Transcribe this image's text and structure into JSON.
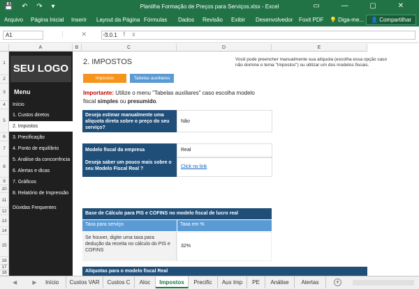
{
  "titlebar": {
    "title": "Planilha Formação de Preços para Serviços.xlsx - Excel",
    "quick_access": "💾 ↶ ↷ ▾",
    "window_controls": "▭ — ▢ ✕"
  },
  "ribbon": {
    "tabs": [
      "Arquivo",
      "Página Inicial",
      "Inserir",
      "Layout da Página",
      "Fórmulas",
      "Dados",
      "Revisão",
      "Exibir",
      "Desenvolvedor",
      "Foxit PDF"
    ],
    "tell_me": "💡 Diga-me...",
    "share": "👤 Compartilhar"
  },
  "formula_bar": {
    "name_box": "A1",
    "icons": "⋮ ✕ ✓ fx",
    "value": "3.0.1"
  },
  "columns": [
    "A",
    "B",
    "C",
    "D",
    "E"
  ],
  "rows": [
    "1",
    "2",
    "3",
    "4",
    "5",
    "6",
    "7",
    "8",
    "9",
    "10",
    "11",
    "12",
    "13",
    "14",
    "15",
    "16",
    "17",
    "18"
  ],
  "sidebar": {
    "logo": "SEU LOGO",
    "menu_title": "Menu",
    "items": [
      "Início",
      "1. Custos diretos",
      "2. Impostos",
      "3. Precificação",
      "4. Ponto de equilíbrio",
      "5. Análise da concorrência",
      "6. Alertas e dicas",
      "7. Gráficos",
      "8. Relatório de Impressão",
      "Dúvidas Frequentes"
    ]
  },
  "main": {
    "title": "2. IMPOSTOS",
    "btn_impostos": "Impostos",
    "btn_tabelas": "Tabelas auxiliares",
    "note": "Você pode preencher manualmente sua alíquota (escolha essa opção caso não domine o tema \"Impostos\") ou utilizar um dos modelos fiscais.",
    "important_label": "Importante:",
    "important_text1": " Utilize o menu \"Tabelas auxiliares\" caso escolha modelo fiscal ",
    "important_simples": "simples",
    "important_or": " ou ",
    "important_presumido": "presumido",
    "important_end": ".",
    "q1": "Deseja estimar manualmente uma alíquota direta sobre o preço do seu serviço?",
    "a1": "Não",
    "q2": "Modelo fiscal da empresa",
    "a2": "Real",
    "q3": "Deseja saber um pouco mais sobre o seu Modelo Fiscal Real ?",
    "a3": "Click no link",
    "base_title": "Base de Cálculo para PIS e COFINS no modelo fiscal de lucro real",
    "col_taxa": "Taxa para serviço",
    "col_taxa_pct": "Taxa em %",
    "deducao": "Se houver, digite uma taxa para dedução da receita no cálculo do PIS e COFINS",
    "deducao_val": "32%",
    "aliquotas_title": "Alíquotas para o modelo fiscal Real"
  },
  "sheet_tabs": [
    "Início",
    "Custos VAR",
    "Custos C",
    "Aloc",
    "Impostos",
    "Precific",
    "Aux Imp",
    "PE",
    "Análise",
    "Alertas"
  ],
  "sheet_nav": "◀ ▶ …",
  "add_sheet": "+",
  "colors": {
    "excel_green": "#217346",
    "dark_blue": "#1f4e79",
    "mid_blue": "#5b9bd5",
    "orange": "#f7941d",
    "red": "#c00000"
  }
}
